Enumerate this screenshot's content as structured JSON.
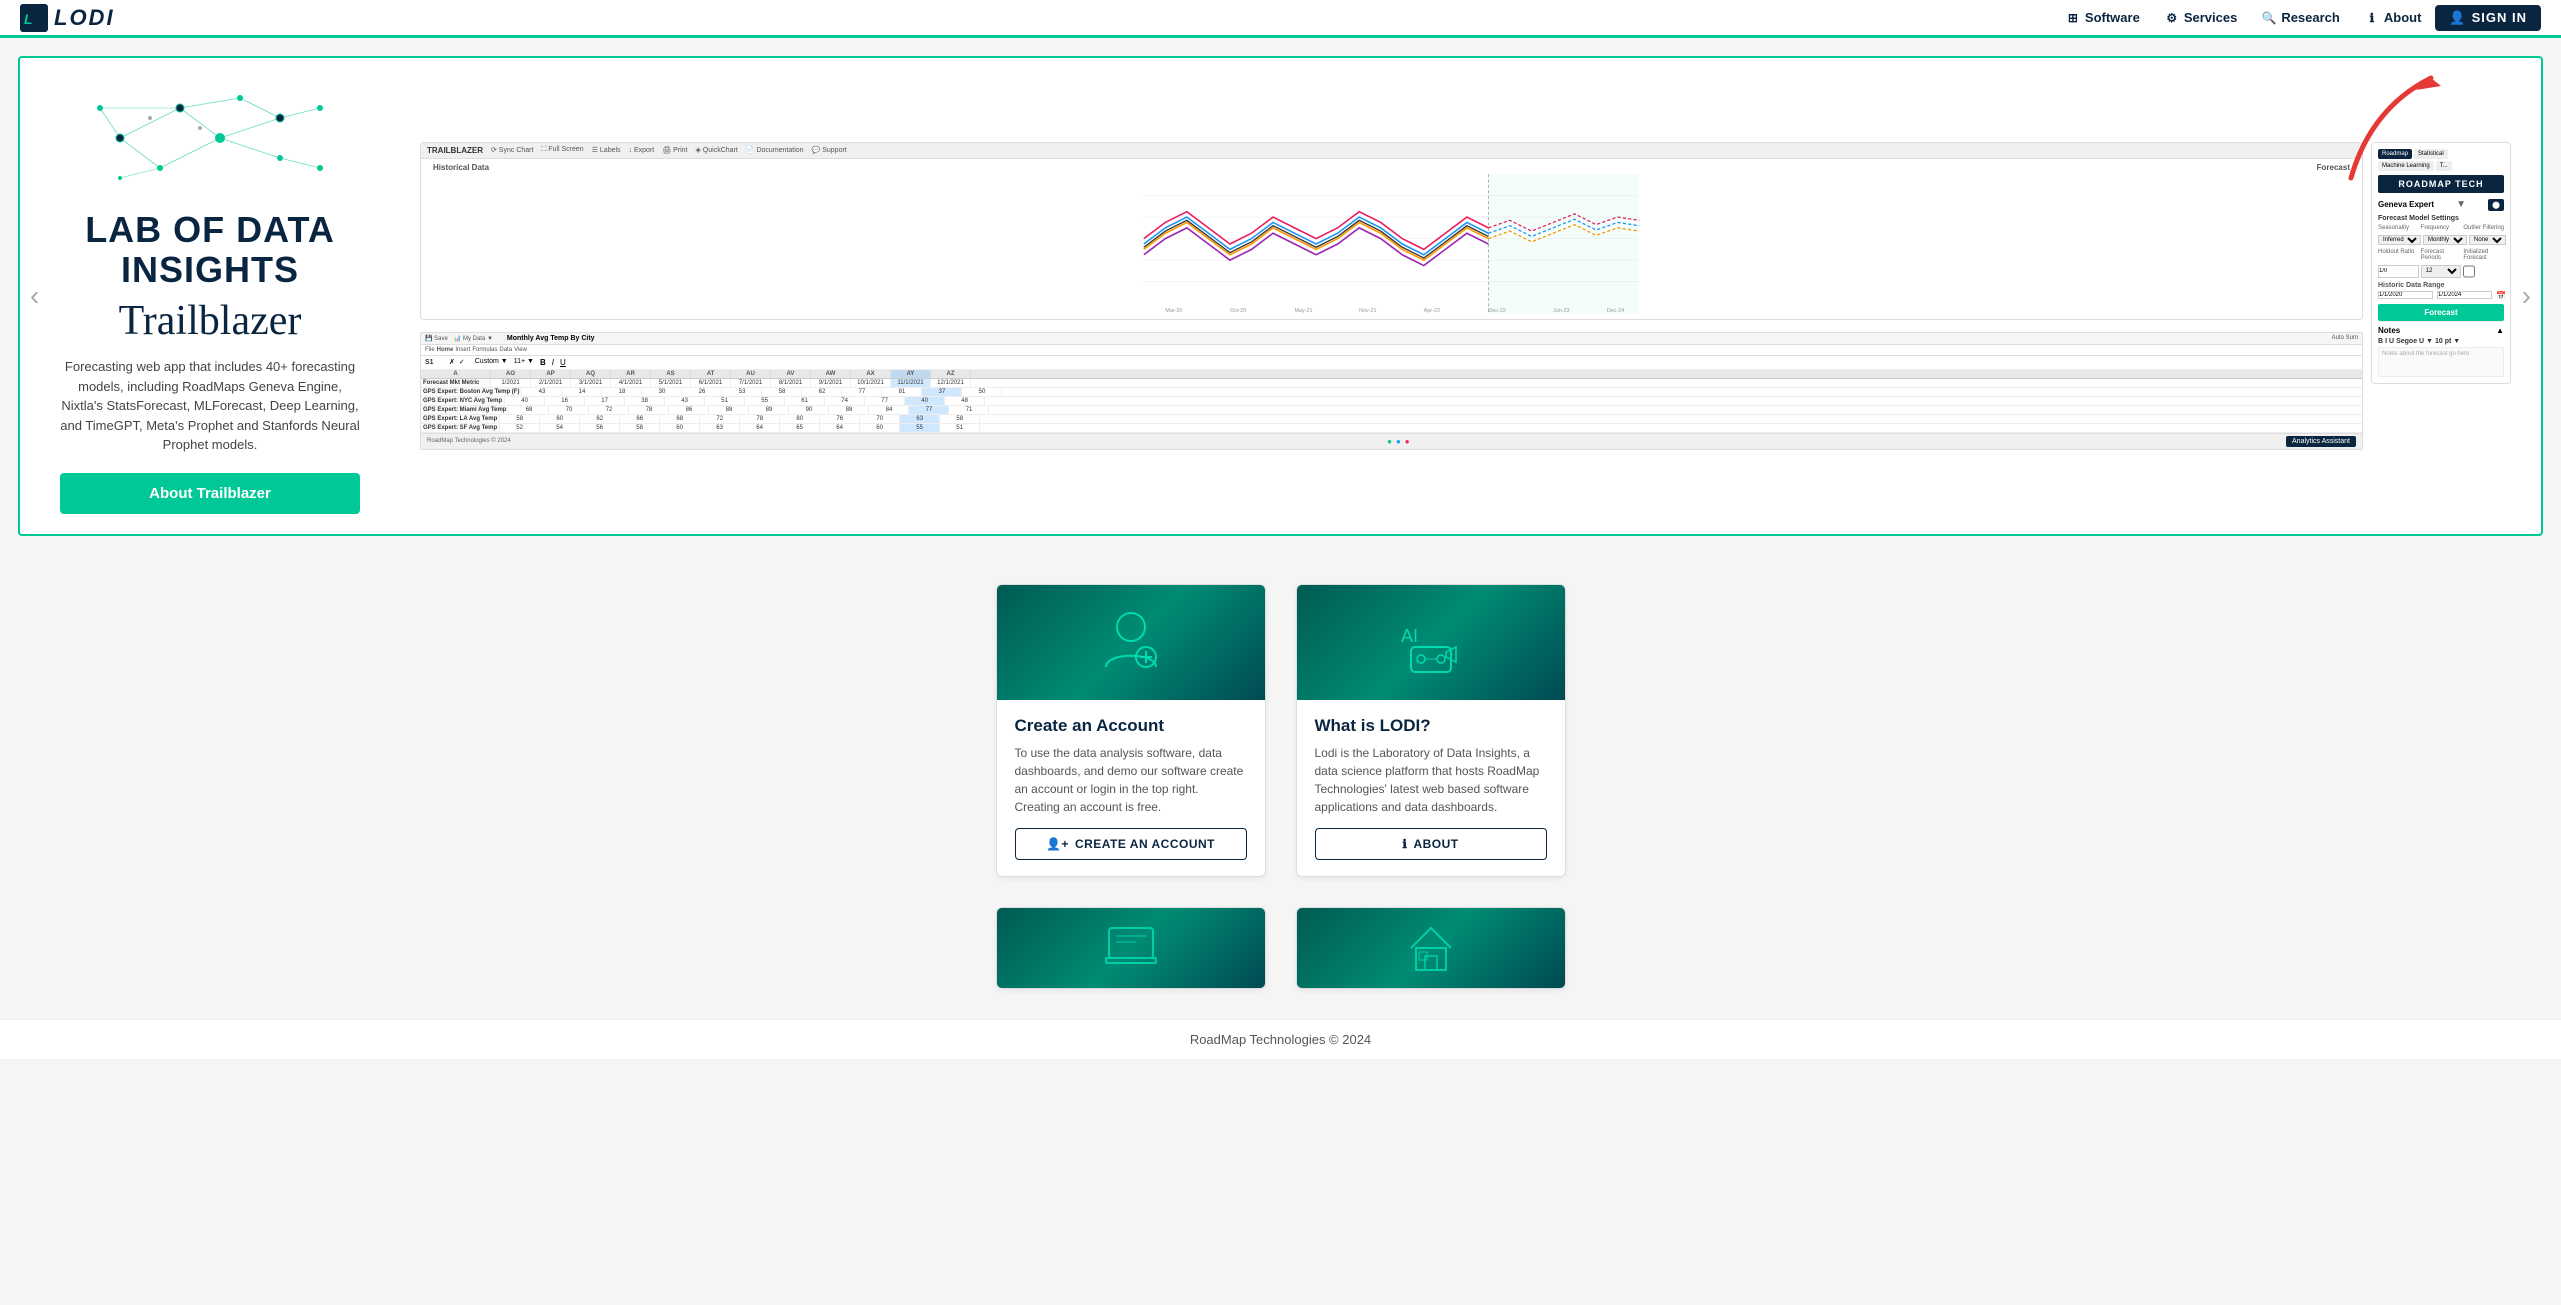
{
  "header": {
    "logo_text": "LODI",
    "nav_items": [
      {
        "label": "Software",
        "icon": "grid-icon"
      },
      {
        "label": "Services",
        "icon": "services-icon"
      },
      {
        "label": "Research",
        "icon": "research-icon"
      },
      {
        "label": "About",
        "icon": "info-icon"
      }
    ],
    "signin_label": "SIGN IN"
  },
  "hero": {
    "brand_title": "LAB OF DATA INSIGHTS",
    "product_name": "Trailblazer",
    "description": "Forecasting web app that includes 40+ forecasting models, including RoadMaps Geneva Engine, Nixtla's StatsForecast, MLForecast, Deep Learning, and TimeGPT, Meta's Prophet and Stanfords Neural Prophet models.",
    "cta_button": "About Trailblazer",
    "nav_prev": "‹",
    "nav_next": "›",
    "screenshot": {
      "app_name": "TRAILBLAZER",
      "toolbar_items": [
        "Sync Chart",
        "Full Screen",
        "Labels",
        "Export",
        "Print",
        "QuickChart",
        "Documentation",
        "Support"
      ],
      "chart_title_left": "Historical Data",
      "chart_title_right": "Forecast",
      "tabs": [
        "Roadmap",
        "Statistical",
        "Machine Learning"
      ],
      "right_panel_title": "ROADMAP TECH",
      "model_label": "Geneva Expert",
      "settings_label": "Forecast Model Settings",
      "seasonality_label": "Seasonality",
      "frequency_label": "Frequency",
      "frequency_value": "Monthly",
      "outlier_label": "Outlier Filtering",
      "holdout_label": "Holdout Ratio",
      "holdout_value": "1/0",
      "forecast_periods_label": "Forecast Periods",
      "forecast_periods_value": "12",
      "initial_forecast_label": "Initialized Forecast",
      "date_range_label": "Historic Data Range",
      "date_start": "1/1/2020",
      "date_end": "1/1/2024",
      "forecast_button": "Forecast",
      "notes_title": "Notes",
      "notes_placeholder": "Notes about the forecast go here",
      "spreadsheet_title": "Monthly Avg Temp By City",
      "footer_text": "RoadMap Technologies © 2024",
      "analytics_btn": "Analytics Assistant"
    }
  },
  "cards": [
    {
      "id": "create-account",
      "title": "Create an Account",
      "text": "To use the data analysis software, data dashboards, and demo our software create an account or login in the top right. Creating an account is free.",
      "button_label": "CREATE AN ACCOUNT",
      "button_icon": "person-add-icon",
      "image_icon": "👤"
    },
    {
      "id": "what-is-lodi",
      "title": "What is LODI?",
      "text": "Lodi is the Laboratory of Data Insights, a data science platform that hosts RoadMap Technologies' latest web based software applications and data dashboards.",
      "button_label": "ABOUT",
      "button_icon": "info-circle-icon",
      "image_icon": "🤖"
    }
  ],
  "bottom_cards": [
    {
      "id": "card-bottom-left",
      "image_icon": "💻"
    },
    {
      "id": "card-bottom-right",
      "image_icon": "🏠"
    }
  ],
  "footer": {
    "text": "RoadMap Technologies © 2024"
  }
}
